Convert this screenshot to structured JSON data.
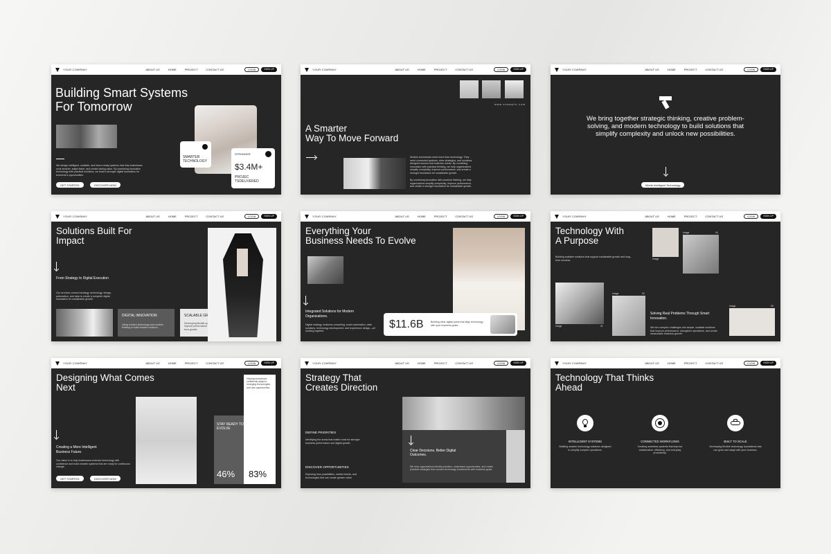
{
  "nav": {
    "brand": "YOUR COMPANY",
    "links": [
      "ABOUT US",
      "HOME",
      "PROJECT",
      "CONTACT US"
    ],
    "login": "LOGIN",
    "signup": "SIGN UP"
  },
  "s1": {
    "title": "Building Smart Systems\nFor Tomorrow",
    "body": "We design intelligent, scalable, and future-ready systems that help businesses work smarter, adapt faster, and create lasting value. By combining innovative technology with practical solutions, we build a stronger digital foundation for tomorrow's opportunities.",
    "btn1": "GET STARTED",
    "btn2": "DISCOVER NOW",
    "card_small": "SMARTER\nTECHNOLOGY",
    "card_label": "STRONGER",
    "card_value": "$3.4M+",
    "card_sub": "PROJEC\nTSDELIVERED"
  },
  "s2": {
    "url": "www.example.com",
    "title": "A Smarter\nWay To Move Forward",
    "body1": "Modern businesses need more than technology. They need connected systems, clear strategies, and solutions designed around real business needs. By combining innovation with practical thinking, we help organizations simplify complexity, improve performance, and create a stronger foundation for sustainable growth.",
    "body2": "By combining innovation with practical thinking, we help organizations simplify complexity, improve performance, and create a stronger foundation for sustainable growth."
  },
  "s3": {
    "statement": "We bring together strategic thinking, creative problem-solving, and modern technology to build solutions that simplify complexity and unlock new possibilities.",
    "btn": "Meets Intelligent Technology"
  },
  "s4": {
    "title": "Solutions Built For\nImpact",
    "subtitle": "From Strategy to Digital Execution",
    "body": "Our services connect strategy, technology, design, automation, and data to create a complete digital foundation for sustainable growth.",
    "box1_title": "DIGITAL INNOVATION",
    "box1_body": "Using modern technology and creative thinking to build smarter solutions.",
    "box2_title": "SCALABLE GROWTH",
    "box2_body": "Developing flexible systems designed to improve performance and support long-term growth."
  },
  "s5": {
    "title": "Everything Your\nBusiness Needs To Evolve",
    "subtitle": "Integrated Solutions for Modern Organizations.",
    "body": "Digital strategy, business consulting, smart automation, data solutions, technology development, and experience design—all working together.",
    "stat": "$11.6B",
    "stat_body": "Building clear digital plans that align technology with your business goals."
  },
  "s6": {
    "title": "Technology With\nA Purpose",
    "body": "Building scalable solutions that support sustainable growth and long-term success.",
    "tag": "Image",
    "num1": "01",
    "num2": "02",
    "num3": "03",
    "num4": "04",
    "num5": "05",
    "subtitle": "Solving Real Problems Through Smart Innovation.",
    "sub_body": "We turn complex challenges into simple, scalable solutions that improve performance, strengthen operations, and create measurable business growth."
  },
  "s7": {
    "title": "Designing What Comes\nNext",
    "side_text": "Helping businesses confidently adapt to emerging technologies and new opportunities.",
    "box_label": "STAY READY TO\nEVOLVE",
    "pct1": "46%",
    "pct2": "83%",
    "subtitle": "Creating a More Intelligent Business Future.",
    "body": "Our vision is to help businesses embrace technology with confidence and build smarter systems that are ready for continuous change.",
    "btn1": "GET STARTED",
    "btn2": "DISCOVER NOW"
  },
  "s8": {
    "title": "Strategy That\nCreates Direction",
    "h1": "DEFINE PRIORITIES",
    "b1": "Identifying the areas that matter most for stronger business performance and digital growth.",
    "h2": "DISCOVER OPPORTUNITIES",
    "b2": "Exploring new possibilities, market trends, and technologies that can create greater value.",
    "box_title": "Clear Decisions. Better Digital Outcomes.",
    "box_body": "We help organizations identify priorities, understand opportunities, and create practical strategies that connect technology investments with business goals."
  },
  "s9": {
    "title": "Technology That Thinks\nAhead",
    "items": [
      {
        "title": "INTELLIGENT SYSTEMS",
        "body": "Building smarter technology solutions designed to simplify complex operations."
      },
      {
        "title": "CONNECTED WORKFLOWS",
        "body": "Creating seamless systems that improve collaboration, efficiency, and everyday productivity."
      },
      {
        "title": "BUILT TO SCALE",
        "body": "Developing flexible technology foundations that can grow and adapt with your business."
      }
    ]
  },
  "colors": {
    "slide_bg": "#262626",
    "page_bg": "#ececea",
    "accent": "#ffffff"
  }
}
